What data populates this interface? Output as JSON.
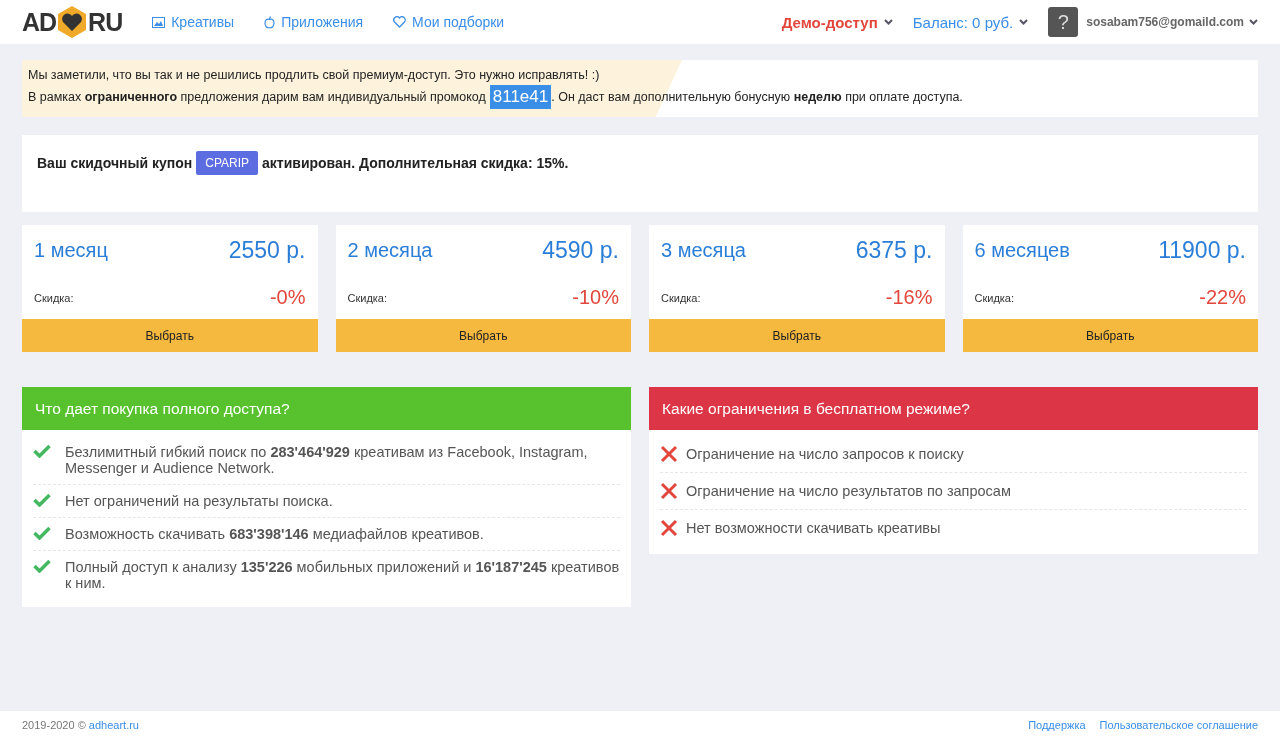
{
  "header": {
    "logo": {
      "left": "AD",
      "right": "RU"
    },
    "nav": [
      {
        "label": "Креативы",
        "kind": "image"
      },
      {
        "label": "Приложения",
        "kind": "apple"
      },
      {
        "label": "Мои подборки",
        "kind": "heart"
      }
    ],
    "access": "Демо-доступ",
    "balance": "Баланс: 0 руб.",
    "avatar": "?",
    "email": "sosabam756@gomaild.com"
  },
  "notice": {
    "line1": "Мы заметили, что вы так и не решились продлить свой премиум-доступ. Это нужно исправлять! :)",
    "before": "В рамках **ограниченного** предложения дарим вам индивидуальный промокод",
    "code": "811e41",
    "after": ". Он даст вам дополнительную бонусную **неделю** при оплате доступа."
  },
  "coupon": {
    "before": "Ваш скидочный купон",
    "code": "CPARIP",
    "after": "активирован. Дополнительная скидка: 15%."
  },
  "plans": [
    {
      "period": "1 месяц",
      "price": "2550 р.",
      "discount_label": "Скидка:",
      "discount": "-0%",
      "button": "Выбрать"
    },
    {
      "period": "2 месяца",
      "price": "4590 р.",
      "discount_label": "Скидка:",
      "discount": "-10%",
      "button": "Выбрать"
    },
    {
      "period": "3 месяца",
      "price": "6375 р.",
      "discount_label": "Скидка:",
      "discount": "-16%",
      "button": "Выбрать"
    },
    {
      "period": "6 месяцев",
      "price": "11900 р.",
      "discount_label": "Скидка:",
      "discount": "-22%",
      "button": "Выбрать"
    }
  ],
  "panels": [
    {
      "kind": "pro",
      "title": "Что дает покупка полного доступа?",
      "items": [
        "Безлимитный гибкий поиск по **283'464'929** креативам из Facebook, Instagram, Messenger и Audience Network.",
        "Нет ограничений на результаты поиска.",
        "Возможность скачивать **683'398'146** медиафайлов креативов.",
        "Полный доступ к анализу **135'226** мобильных приложений и **16'187'245** креативов к ним."
      ]
    },
    {
      "kind": "con",
      "title": "Какие ограничения в бесплатном режиме?",
      "items": [
        "Ограничение на число запросов к поиску",
        "Ограничение на число результатов по запросам",
        "Нет возможности скачивать креативы"
      ]
    }
  ],
  "footer": {
    "copyright": "2019-2020 ©",
    "site": "adheart.ru",
    "links": [
      "Поддержка",
      "Пользовательское соглашение"
    ]
  }
}
